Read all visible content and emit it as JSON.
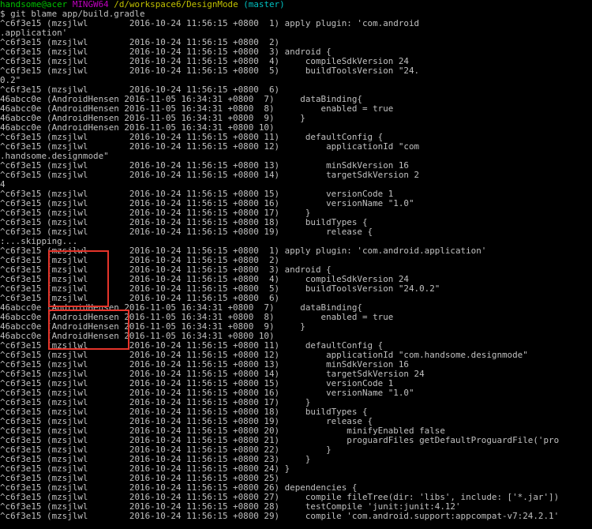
{
  "prompt": {
    "user_host": "handsome@acer",
    "env": "MINGW64",
    "path": "/d/workspace6/DesignMode",
    "branch": "(master)"
  },
  "command": "$ git blame app/build.gradle",
  "lines_first": [
    "^c6f3e15 (mzsjlwl        2016-10-24 11:56:15 +0800  1) apply plugin: 'com.android",
    ".application'",
    "^c6f3e15 (mzsjlwl        2016-10-24 11:56:15 +0800  2)",
    "^c6f3e15 (mzsjlwl        2016-10-24 11:56:15 +0800  3) android {",
    "^c6f3e15 (mzsjlwl        2016-10-24 11:56:15 +0800  4)     compileSdkVersion 24",
    "^c6f3e15 (mzsjlwl        2016-10-24 11:56:15 +0800  5)     buildToolsVersion \"24.",
    "0.2\"",
    "^c6f3e15 (mzsjlwl        2016-10-24 11:56:15 +0800  6)",
    "46abcc0e (AndroidHensen 2016-11-05 16:34:31 +0800  7)     dataBinding{",
    "46abcc0e (AndroidHensen 2016-11-05 16:34:31 +0800  8)         enabled = true",
    "46abcc0e (AndroidHensen 2016-11-05 16:34:31 +0800  9)     }",
    "46abcc0e (AndroidHensen 2016-11-05 16:34:31 +0800 10)",
    "^c6f3e15 (mzsjlwl        2016-10-24 11:56:15 +0800 11)     defaultConfig {",
    "^c6f3e15 (mzsjlwl        2016-10-24 11:56:15 +0800 12)         applicationId \"com",
    ".handsome.designmode\"",
    "^c6f3e15 (mzsjlwl        2016-10-24 11:56:15 +0800 13)         minSdkVersion 16",
    "^c6f3e15 (mzsjlwl        2016-10-24 11:56:15 +0800 14)         targetSdkVersion 2",
    "4",
    "^c6f3e15 (mzsjlwl        2016-10-24 11:56:15 +0800 15)         versionCode 1",
    "^c6f3e15 (mzsjlwl        2016-10-24 11:56:15 +0800 16)         versionName \"1.0\"",
    "^c6f3e15 (mzsjlwl        2016-10-24 11:56:15 +0800 17)     }",
    "^c6f3e15 (mzsjlwl        2016-10-24 11:56:15 +0800 18)     buildTypes {",
    "^c6f3e15 (mzsjlwl        2016-10-24 11:56:15 +0800 19)         release {"
  ],
  "skipping": ":...skipping...",
  "lines_second": [
    "^c6f3e15 (mzsjlwl        2016-10-24 11:56:15 +0800  1) apply plugin: 'com.android.application'",
    "^c6f3e15 (mzsjlwl        2016-10-24 11:56:15 +0800  2)",
    "^c6f3e15 (mzsjlwl        2016-10-24 11:56:15 +0800  3) android {",
    "^c6f3e15 (mzsjlwl        2016-10-24 11:56:15 +0800  4)     compileSdkVersion 24",
    "^c6f3e15 (mzsjlwl        2016-10-24 11:56:15 +0800  5)     buildToolsVersion \"24.0.2\"",
    "^c6f3e15 (mzsjlwl        2016-10-24 11:56:15 +0800  6)",
    "46abcc0e (AndroidHensen 2016-11-05 16:34:31 +0800  7)     dataBinding{",
    "46abcc0e (AndroidHensen 2016-11-05 16:34:31 +0800  8)         enabled = true",
    "46abcc0e (AndroidHensen 2016-11-05 16:34:31 +0800  9)     }",
    "46abcc0e (AndroidHensen 2016-11-05 16:34:31 +0800 10)",
    "^c6f3e15 (mzsjlwl        2016-10-24 11:56:15 +0800 11)     defaultConfig {",
    "^c6f3e15 (mzsjlwl        2016-10-24 11:56:15 +0800 12)         applicationId \"com.handsome.designmode\"",
    "^c6f3e15 (mzsjlwl        2016-10-24 11:56:15 +0800 13)         minSdkVersion 16",
    "^c6f3e15 (mzsjlwl        2016-10-24 11:56:15 +0800 14)         targetSdkVersion 24",
    "^c6f3e15 (mzsjlwl        2016-10-24 11:56:15 +0800 15)         versionCode 1",
    "^c6f3e15 (mzsjlwl        2016-10-24 11:56:15 +0800 16)         versionName \"1.0\"",
    "^c6f3e15 (mzsjlwl        2016-10-24 11:56:15 +0800 17)     }",
    "^c6f3e15 (mzsjlwl        2016-10-24 11:56:15 +0800 18)     buildTypes {",
    "^c6f3e15 (mzsjlwl        2016-10-24 11:56:15 +0800 19)         release {",
    "^c6f3e15 (mzsjlwl        2016-10-24 11:56:15 +0800 20)             minifyEnabled false",
    "^c6f3e15 (mzsjlwl        2016-10-24 11:56:15 +0800 21)             proguardFiles getDefaultProguardFile('pro",
    "^c6f3e15 (mzsjlwl        2016-10-24 11:56:15 +0800 22)         }",
    "^c6f3e15 (mzsjlwl        2016-10-24 11:56:15 +0800 23)     }",
    "^c6f3e15 (mzsjlwl        2016-10-24 11:56:15 +0800 24) }",
    "^c6f3e15 (mzsjlwl        2016-10-24 11:56:15 +0800 25)",
    "^c6f3e15 (mzsjlwl        2016-10-24 11:56:15 +0800 26) dependencies {",
    "^c6f3e15 (mzsjlwl        2016-10-24 11:56:15 +0800 27)     compile fileTree(dir: 'libs', include: ['*.jar'])",
    "^c6f3e15 (mzsjlwl        2016-10-24 11:56:15 +0800 28)     testCompile 'junit:junit:4.12'",
    "^c6f3e15 (mzsjlwl        2016-10-24 11:56:15 +0800 29)     compile 'com.android.support:appcompat-v7:24.2.1'"
  ],
  "colors": {
    "background": "#000000",
    "text": "#c0c0c0",
    "prompt_user": "#00c000",
    "prompt_env": "#c000c0",
    "prompt_path": "#c0c000",
    "prompt_branch": "#00c0c0",
    "highlight_box": "#e5342a"
  }
}
